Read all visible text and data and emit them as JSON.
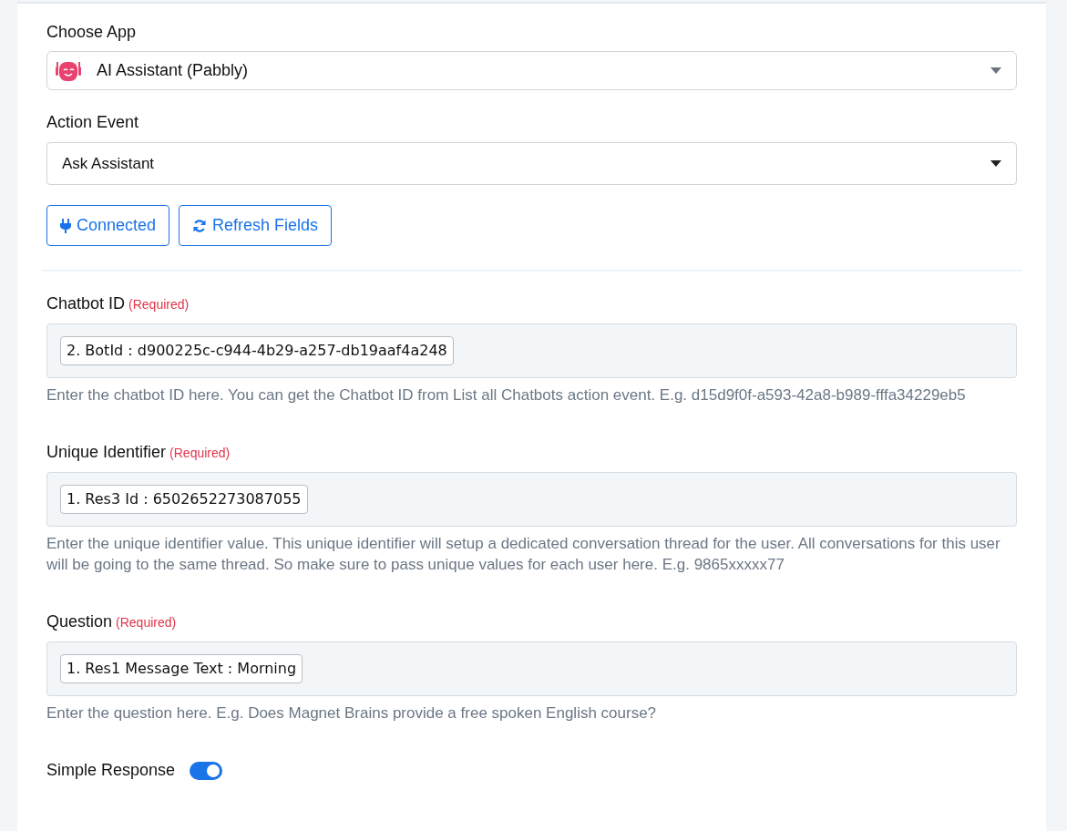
{
  "choose_app": {
    "label": "Choose App",
    "value": "AI Assistant (Pabbly)"
  },
  "action_event": {
    "label": "Action Event",
    "value": "Ask Assistant"
  },
  "buttons": [
    {
      "kind": "connected",
      "label": "Connected"
    },
    {
      "kind": "refresh",
      "label": "Refresh Fields"
    }
  ],
  "fields": [
    {
      "label": "Chatbot ID",
      "required": "(Required)",
      "token": "2. BotId : d900225c-c944-4b29-a257-db19aaf4a248",
      "help": "Enter the chatbot ID here. You can get the Chatbot ID from List all Chatbots action event. E.g. d15d9f0f-a593-42a8-b989-fffa34229eb5"
    },
    {
      "label": "Unique Identifier",
      "required": "(Required)",
      "token": "1. Res3 Id : 6502652273087055",
      "help": "Enter the unique identifier value. This unique identifier will setup a dedicated conversation thread for the user. All conversations for this user will be going to the same thread. So make sure to pass unique values for each user here. E.g. 9865xxxxx77"
    },
    {
      "label": "Question",
      "required": "(Required)",
      "token": "1. Res1 Message Text : Morning",
      "help": "Enter the question here. E.g. Does Magnet Brains provide a free spoken English course?"
    }
  ],
  "simple_response": {
    "label": "Simple Response",
    "on": true
  }
}
